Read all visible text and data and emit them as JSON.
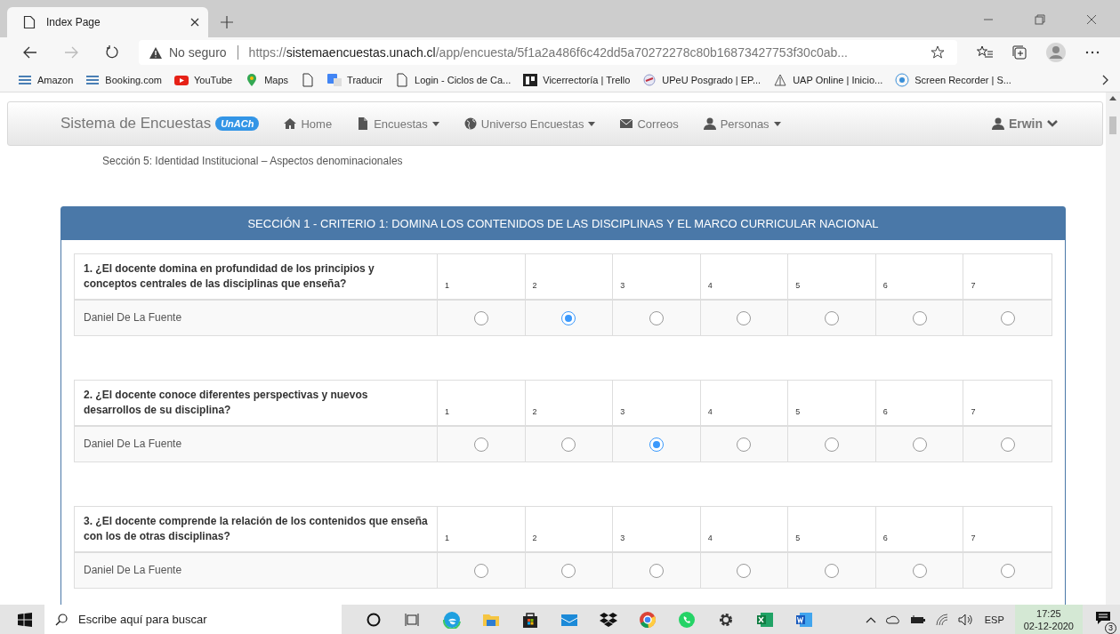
{
  "browser": {
    "tabs": [
      {
        "title": "Index Page",
        "selected": true
      }
    ],
    "address": {
      "security": "No seguro",
      "scheme": "https://",
      "host": "sistemaencuestas.unach.cl",
      "path": "/app/encuesta/5f1a2a486f6c42dd5a70272278c80b16873427753f30c0ab..."
    },
    "bookmarks": [
      {
        "kind": "amazon",
        "label": "Amazon"
      },
      {
        "kind": "booking",
        "label": "Booking.com"
      },
      {
        "kind": "youtube",
        "label": "YouTube"
      },
      {
        "kind": "maps",
        "label": "Maps"
      },
      {
        "kind": "page"
      },
      {
        "kind": "translate",
        "label": "Traducir"
      },
      {
        "kind": "page",
        "label": "Login - Ciclos de Ca..."
      },
      {
        "kind": "trello",
        "label": "Vicerrectoría | Trello"
      },
      {
        "kind": "emblem",
        "label": "UPeU Posgrado | EP..."
      },
      {
        "kind": "uap",
        "label": "UAP Online | Inicio..."
      },
      {
        "kind": "recorder",
        "label": "Screen Recorder | S..."
      }
    ]
  },
  "navbar": {
    "brand": "Sistema de Encuestas",
    "badge": "UnACh",
    "items": [
      {
        "kind": "home",
        "label": "Home",
        "dropdown": false
      },
      {
        "kind": "file",
        "label": "Encuestas",
        "dropdown": true
      },
      {
        "kind": "globe",
        "label": "Universo Encuestas",
        "dropdown": true
      },
      {
        "kind": "envelope",
        "label": "Correos",
        "dropdown": false
      },
      {
        "kind": "user",
        "label": "Personas",
        "dropdown": true
      }
    ],
    "user": {
      "label": "Erwin"
    }
  },
  "subtitle": "Sección 5: Identidad Institucional – Aspectos denominacionales",
  "panel": {
    "title": "SECCIÓN 1 - CRITERIO 1: DOMINA LOS CONTENIDOS DE LAS DISCIPLINAS Y EL MARCO CURRICULAR NACIONAL",
    "questions": [
      {
        "text": "1. ¿El docente domina en profundidad de los principios y conceptos centrales de las disciplinas que enseña?",
        "scale": [
          "1",
          "2",
          "3",
          "4",
          "5",
          "6",
          "7"
        ],
        "respondent": "Daniel De La Fuente",
        "options": [
          {
            "selected": false
          },
          {
            "selected": true
          },
          {
            "selected": false
          },
          {
            "selected": false
          },
          {
            "selected": false
          },
          {
            "selected": false
          },
          {
            "selected": false
          }
        ]
      },
      {
        "text": "2. ¿El docente conoce diferentes perspectivas y nuevos desarrollos de su disciplina?",
        "scale": [
          "1",
          "2",
          "3",
          "4",
          "5",
          "6",
          "7"
        ],
        "respondent": "Daniel De La Fuente",
        "options": [
          {
            "selected": false
          },
          {
            "selected": false
          },
          {
            "selected": true
          },
          {
            "selected": false
          },
          {
            "selected": false
          },
          {
            "selected": false
          },
          {
            "selected": false
          }
        ]
      },
      {
        "text": "3. ¿El docente comprende la relación de los contenidos que enseña con los de otras disciplinas?",
        "scale": [
          "1",
          "2",
          "3",
          "4",
          "5",
          "6",
          "7"
        ],
        "respondent": "Daniel De La Fuente",
        "options": [
          {
            "selected": false
          },
          {
            "selected": false
          },
          {
            "selected": false
          },
          {
            "selected": false
          },
          {
            "selected": false
          },
          {
            "selected": false
          },
          {
            "selected": false
          }
        ]
      }
    ]
  },
  "taskbar": {
    "search_placeholder": "Escribe aquí para buscar",
    "apps": [
      {
        "kind": "cortana"
      },
      {
        "kind": "taskview"
      },
      {
        "kind": "edge"
      },
      {
        "kind": "folder"
      },
      {
        "kind": "store"
      },
      {
        "kind": "mail"
      },
      {
        "kind": "dropbox"
      },
      {
        "kind": "chrome"
      },
      {
        "kind": "whatsapp"
      },
      {
        "kind": "gear"
      },
      {
        "kind": "excel"
      },
      {
        "kind": "word"
      }
    ],
    "language": "ESP",
    "time": "17:25",
    "date": "02-12-2020",
    "notifications": "3"
  }
}
